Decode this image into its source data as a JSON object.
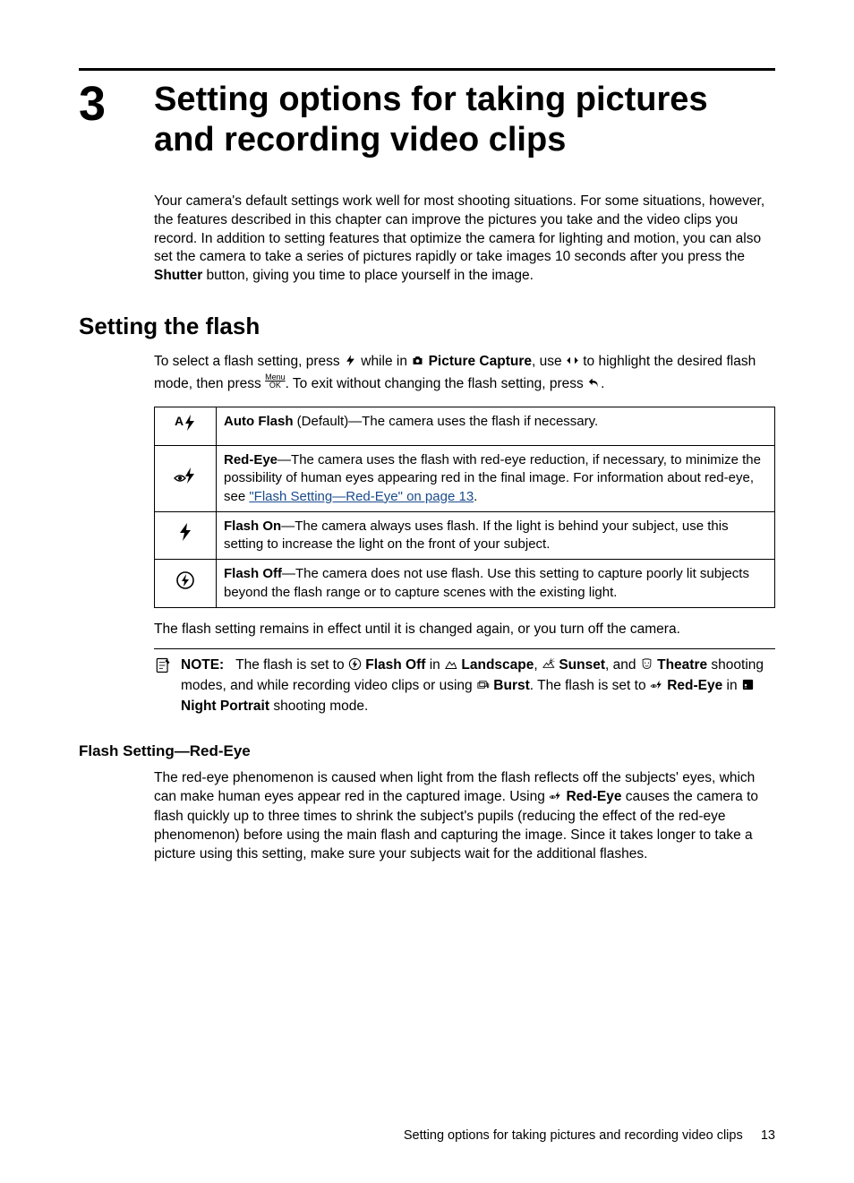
{
  "chapter": {
    "number": "3",
    "title": "Setting options for taking pictures and recording video clips"
  },
  "intro": {
    "before_shutter": "Your camera's default settings work well for most shooting situations. For some situations, however, the features described in this chapter can improve the pictures you take and the video clips you record. In addition to setting features that optimize the camera for lighting and motion, you can also set the camera to take a series of pictures rapidly or take images 10 seconds after you press the ",
    "shutter": "Shutter",
    "after_shutter": " button, giving you time to place yourself in the image."
  },
  "section1": {
    "heading": "Setting the flash",
    "p1_a": "To select a flash setting, press ",
    "p1_b": " while in ",
    "p1_pc": "Picture Capture",
    "p1_c": ", use ",
    "p1_d": " to highlight the desired flash mode, then press ",
    "p1_e": ". To exit without changing the flash setting, press ",
    "p1_f": ".",
    "menuok_top": "Menu",
    "menuok_bot": "OK",
    "table": [
      {
        "icon_letter": "A",
        "name": "Auto Flash",
        "suffix": " (Default)—The camera uses the flash if necessary."
      },
      {
        "name": "Red-Eye",
        "suffix_a": "—The camera uses the flash with red-eye reduction, if necessary, to minimize the possibility of human eyes appearing red in the final image. For information about red-eye, see ",
        "link": "\"Flash Setting—Red-Eye\" on page 13",
        "suffix_b": "."
      },
      {
        "name": "Flash On",
        "suffix": "—The camera always uses flash. If the light is behind your subject, use this setting to increase the light on the front of your subject."
      },
      {
        "name": "Flash Off",
        "suffix": "—The camera does not use flash. Use this setting to capture poorly lit subjects beyond the flash range or to capture scenes with the existing light."
      }
    ],
    "after_table": "The flash setting remains in effect until it is changed again, or you turn off the camera.",
    "note": {
      "label": "NOTE:",
      "t1": "The flash is set to ",
      "flash_off": "Flash Off",
      "t2": " in ",
      "landscape": "Landscape",
      "comma": ", ",
      "sunset": "Sunset",
      "t3": ", and ",
      "theatre": "Theatre",
      "t4": " shooting modes, and while recording video clips or using ",
      "burst": "Burst",
      "t5": ". The flash is set to ",
      "redeye": "Red-Eye",
      "t6": " in ",
      "night_portrait": "Night Portrait",
      "t7": " shooting mode."
    }
  },
  "section2": {
    "heading": "Flash Setting—Red-Eye",
    "p_a": "The red-eye phenomenon is caused when light from the flash reflects off the subjects' eyes, which can make human eyes appear red in the captured image. Using ",
    "redeye": "Red-Eye",
    "p_b": " causes the camera to flash quickly up to three times to shrink the subject's pupils (reducing the effect of the red-eye phenomenon) before using the main flash and capturing the image. Since it takes longer to take a picture using this setting, make sure your subjects wait for the additional flashes."
  },
  "footer": {
    "text": "Setting options for taking pictures and recording video clips",
    "page": "13"
  },
  "chart_data": null
}
